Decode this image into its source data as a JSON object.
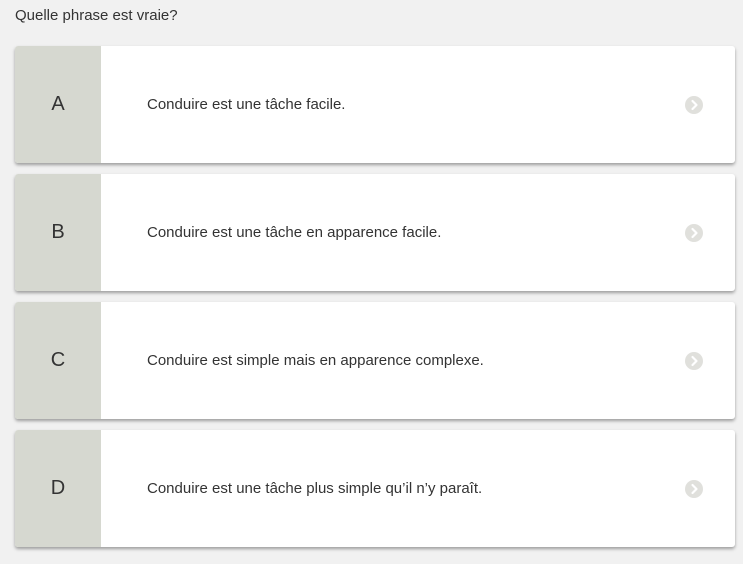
{
  "question": "Quelle phrase est vraie?",
  "options": [
    {
      "letter": "A",
      "text": "Conduire est une tâche facile."
    },
    {
      "letter": "B",
      "text": "Conduire est une tâche en apparence facile."
    },
    {
      "letter": "C",
      "text": "Conduire est simple mais en apparence complexe."
    },
    {
      "letter": "D",
      "text": "Conduire est une tâche plus simple qu’il n’y paraît."
    }
  ],
  "colors": {
    "letter_bg": "#d6d8d0",
    "card_bg": "#ffffff",
    "page_bg": "#f1f1f1",
    "arrow": "#e0e0dc"
  },
  "icons": {
    "option_arrow": "chevron-right-circle-icon"
  }
}
